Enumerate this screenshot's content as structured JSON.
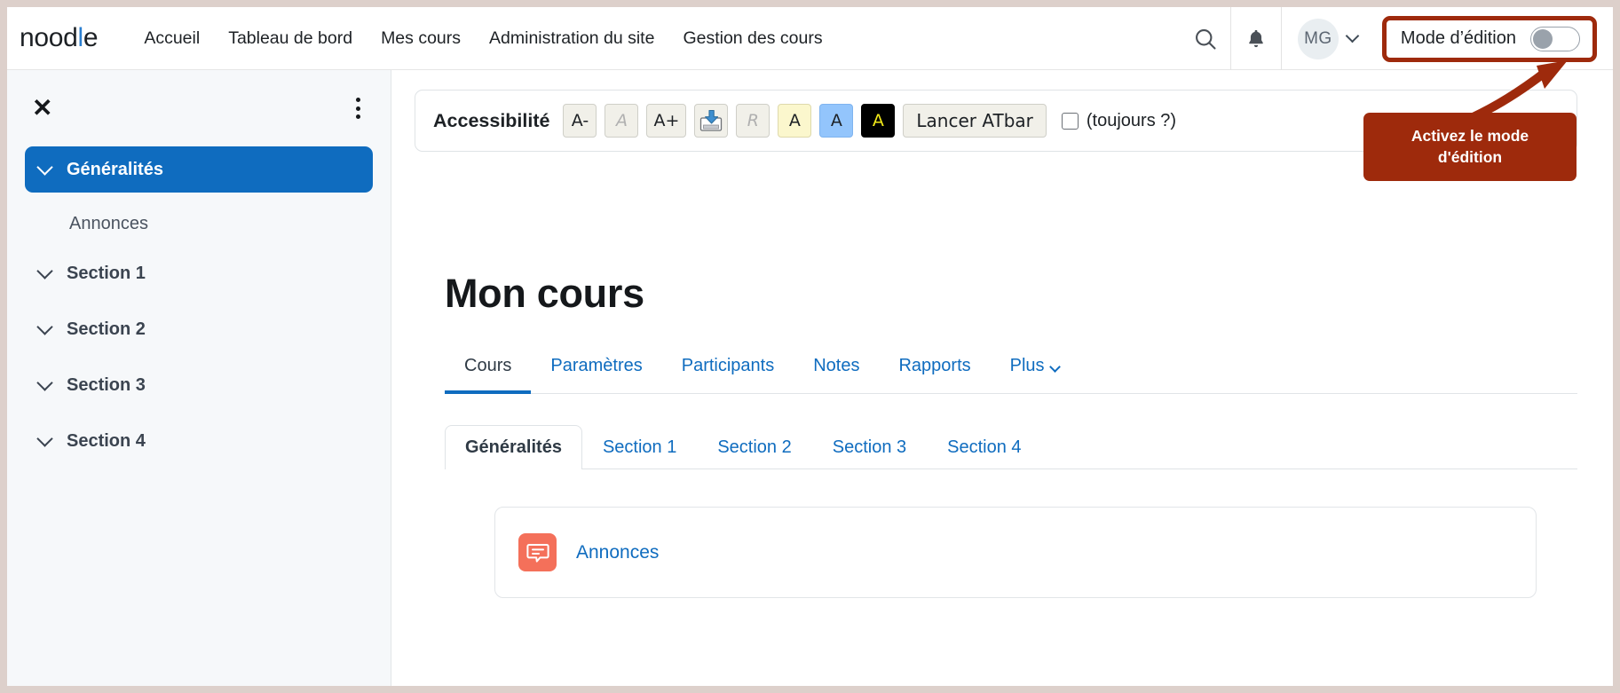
{
  "brand": {
    "text_before": "nood",
    "tick": "l",
    "text_after": "e",
    "full": "noodle"
  },
  "navbar": {
    "links": [
      {
        "label": "Accueil",
        "name": "nav-link-accueil"
      },
      {
        "label": "Tableau de bord",
        "name": "nav-link-tableau-de-bord"
      },
      {
        "label": "Mes cours",
        "name": "nav-link-mes-cours"
      },
      {
        "label": "Administration du site",
        "name": "nav-link-administration-du-site"
      },
      {
        "label": "Gestion des cours",
        "name": "nav-link-gestion-des-cours"
      }
    ],
    "search_icon": "search-icon",
    "notification_icon": "bell-icon",
    "avatar_initials": "MG",
    "avatar_chevron": "chevron-down-icon",
    "edit_mode": {
      "label": "Mode d’édition",
      "toggle_state": "off",
      "highlight_color": "#9e2a0c"
    }
  },
  "callout": {
    "line1": "Activez le mode",
    "line2": "d'édition",
    "background": "#9e2a0c",
    "text_color": "#ffffff"
  },
  "sidebar": {
    "close_icon": "close-icon",
    "menu_icon": "kebab-menu-icon",
    "items": [
      {
        "label": "Généralités",
        "active": true,
        "type": "section",
        "name": "sidebar-item-generalites"
      },
      {
        "label": "Annonces",
        "active": false,
        "type": "activity",
        "name": "sidebar-item-annonces"
      },
      {
        "label": "Section 1",
        "active": false,
        "type": "section",
        "name": "sidebar-item-section-1"
      },
      {
        "label": "Section 2",
        "active": false,
        "type": "section",
        "name": "sidebar-item-section-2"
      },
      {
        "label": "Section 3",
        "active": false,
        "type": "section",
        "name": "sidebar-item-section-3"
      },
      {
        "label": "Section 4",
        "active": false,
        "type": "section",
        "name": "sidebar-item-section-4"
      }
    ],
    "active_color": "#0f6cbf"
  },
  "accessibility": {
    "title": "Accessibilité",
    "buttons": [
      {
        "label": "A-",
        "style": "normal",
        "name": "decrease-font-button"
      },
      {
        "label": "A",
        "style": "dim",
        "name": "reset-font-button"
      },
      {
        "label": "A+",
        "style": "normal",
        "name": "increase-font-button"
      },
      {
        "label": "",
        "style": "icon",
        "icon": "save-disk-icon",
        "name": "save-settings-button"
      },
      {
        "label": "R",
        "style": "dim",
        "name": "reset-button"
      },
      {
        "label": "A",
        "style": "yellow",
        "name": "yellow-contrast-button"
      },
      {
        "label": "A",
        "style": "blue",
        "name": "blue-contrast-button"
      },
      {
        "label": "A",
        "style": "black",
        "name": "black-contrast-button"
      }
    ],
    "launch_button": "Lancer ATbar",
    "checkbox_label": "(toujours ?)",
    "checkbox_checked": false
  },
  "main": {
    "course_title": "Mon cours",
    "primary_tabs": [
      {
        "label": "Cours",
        "active": true,
        "name": "tab-cours"
      },
      {
        "label": "Paramètres",
        "active": false,
        "name": "tab-parametres"
      },
      {
        "label": "Participants",
        "active": false,
        "name": "tab-participants"
      },
      {
        "label": "Notes",
        "active": false,
        "name": "tab-notes"
      },
      {
        "label": "Rapports",
        "active": false,
        "name": "tab-rapports"
      },
      {
        "label": "Plus",
        "active": false,
        "has_chevron": true,
        "name": "tab-plus"
      }
    ],
    "section_tabs": [
      {
        "label": "Généralités",
        "active": true,
        "name": "section-tab-generalites"
      },
      {
        "label": "Section 1",
        "active": false,
        "name": "section-tab-1"
      },
      {
        "label": "Section 2",
        "active": false,
        "name": "section-tab-2"
      },
      {
        "label": "Section 3",
        "active": false,
        "name": "section-tab-3"
      },
      {
        "label": "Section 4",
        "active": false,
        "name": "section-tab-4"
      }
    ],
    "activities": [
      {
        "label": "Annonces",
        "icon": "forum-icon",
        "icon_color": "#f4705a",
        "name": "activity-annonces"
      }
    ]
  }
}
